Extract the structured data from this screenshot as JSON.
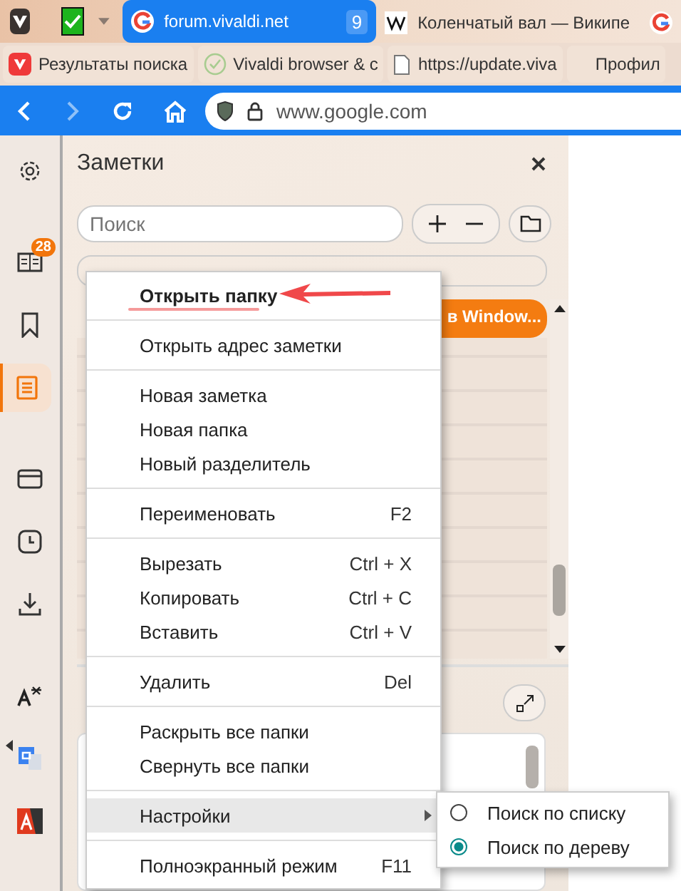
{
  "tab_bar": {
    "tabs": [
      {
        "title": "forum.vivaldi.net",
        "badge": "9",
        "selected": true
      },
      {
        "title": "Коленчатый вал — Википе",
        "selected": false
      },
      {
        "selected": false
      }
    ]
  },
  "bookmarks": [
    {
      "title": "Результаты поиска"
    },
    {
      "title": "Vivaldi browser & c"
    },
    {
      "title": "https://update.viva"
    },
    {
      "title": "Профил"
    }
  ],
  "address_bar": {
    "url": "www.google.com"
  },
  "sidebar": {
    "items": [
      {
        "kind": "settings",
        "selected": false
      },
      {
        "kind": "reader",
        "selected": false,
        "badge": "28"
      },
      {
        "kind": "bookmarks",
        "selected": false
      },
      {
        "kind": "notes",
        "selected": true
      },
      {
        "kind": "window",
        "selected": false
      },
      {
        "kind": "history",
        "selected": false
      },
      {
        "kind": "downloads",
        "selected": false
      },
      {
        "kind": "translate",
        "selected": false
      },
      {
        "kind": "gtranslate",
        "selected": false
      },
      {
        "kind": "dictionary",
        "selected": false
      }
    ]
  },
  "panel": {
    "title": "Заметки",
    "search": {
      "placeholder": "Поиск"
    },
    "highlighted_note": "в Window..."
  },
  "context_menu": {
    "items": [
      {
        "kind": "item",
        "label": "Открыть папку",
        "bold": true,
        "highlighted": false
      },
      {
        "kind": "separator"
      },
      {
        "kind": "item",
        "label": "Открыть адрес заметки",
        "highlighted": false
      },
      {
        "kind": "separator"
      },
      {
        "kind": "item",
        "label": "Новая заметка",
        "highlighted": false
      },
      {
        "kind": "item",
        "label": "Новая папка",
        "highlighted": false
      },
      {
        "kind": "item",
        "label": "Новый разделитель",
        "highlighted": false
      },
      {
        "kind": "separator"
      },
      {
        "kind": "item",
        "label": "Переименовать",
        "shortcut": "F2",
        "highlighted": false
      },
      {
        "kind": "separator"
      },
      {
        "kind": "item",
        "label": "Вырезать",
        "shortcut": "Ctrl + X",
        "highlighted": false
      },
      {
        "kind": "item",
        "label": "Копировать",
        "shortcut": "Ctrl + C",
        "highlighted": false
      },
      {
        "kind": "item",
        "label": "Вставить",
        "shortcut": "Ctrl + V",
        "highlighted": false
      },
      {
        "kind": "separator"
      },
      {
        "kind": "item",
        "label": "Удалить",
        "shortcut": "Del",
        "highlighted": false
      },
      {
        "kind": "separator"
      },
      {
        "kind": "item",
        "label": "Раскрыть все папки",
        "highlighted": false
      },
      {
        "kind": "item",
        "label": "Свернуть все папки",
        "highlighted": false
      },
      {
        "kind": "separator"
      },
      {
        "kind": "submenu",
        "label": "Настройки",
        "highlighted": true
      },
      {
        "kind": "separator"
      },
      {
        "kind": "item",
        "label": "Полноэкранный режим",
        "shortcut": "F11",
        "highlighted": false
      }
    ]
  },
  "submenu": {
    "options": [
      {
        "label": "Поиск по списку",
        "selected": false
      },
      {
        "label": "Поиск по дереву",
        "selected": true
      }
    ]
  }
}
